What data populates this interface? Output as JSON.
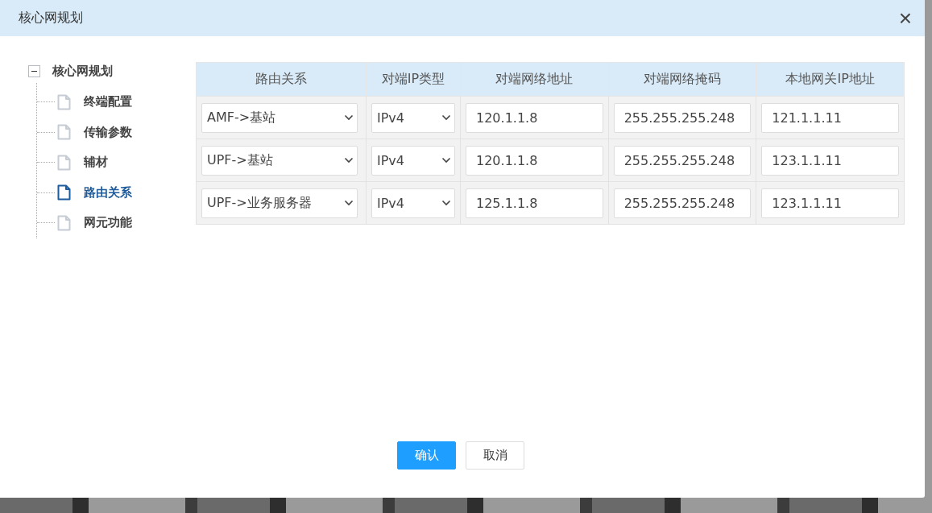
{
  "dialog": {
    "title": "核心网规划",
    "close": "×"
  },
  "tree": {
    "label": "核心网规划",
    "expanded": true,
    "children": [
      {
        "label": "终端配置",
        "selected": false
      },
      {
        "label": "传输参数",
        "selected": false
      },
      {
        "label": "辅材",
        "selected": false
      },
      {
        "label": "路由关系",
        "selected": true
      },
      {
        "label": "网元功能",
        "selected": false
      }
    ]
  },
  "table": {
    "columns": [
      "路由关系",
      "对端IP类型",
      "对端网络地址",
      "对端网络掩码",
      "本地网关IP地址"
    ],
    "rows": [
      {
        "route": "AMF->基站",
        "ip_type": "IPv4",
        "address": "120.1.1.8",
        "mask": "255.255.255.248",
        "gateway": "121.1.1.11"
      },
      {
        "route": "UPF->基站",
        "ip_type": "IPv4",
        "address": "120.1.1.8",
        "mask": "255.255.255.248",
        "gateway": "123.1.1.11"
      },
      {
        "route": "UPF->业务服务器",
        "ip_type": "IPv4",
        "address": "125.1.1.8",
        "mask": "255.255.255.248",
        "gateway": "123.1.1.11"
      }
    ]
  },
  "buttons": {
    "confirm": "确认",
    "cancel": "取消"
  }
}
